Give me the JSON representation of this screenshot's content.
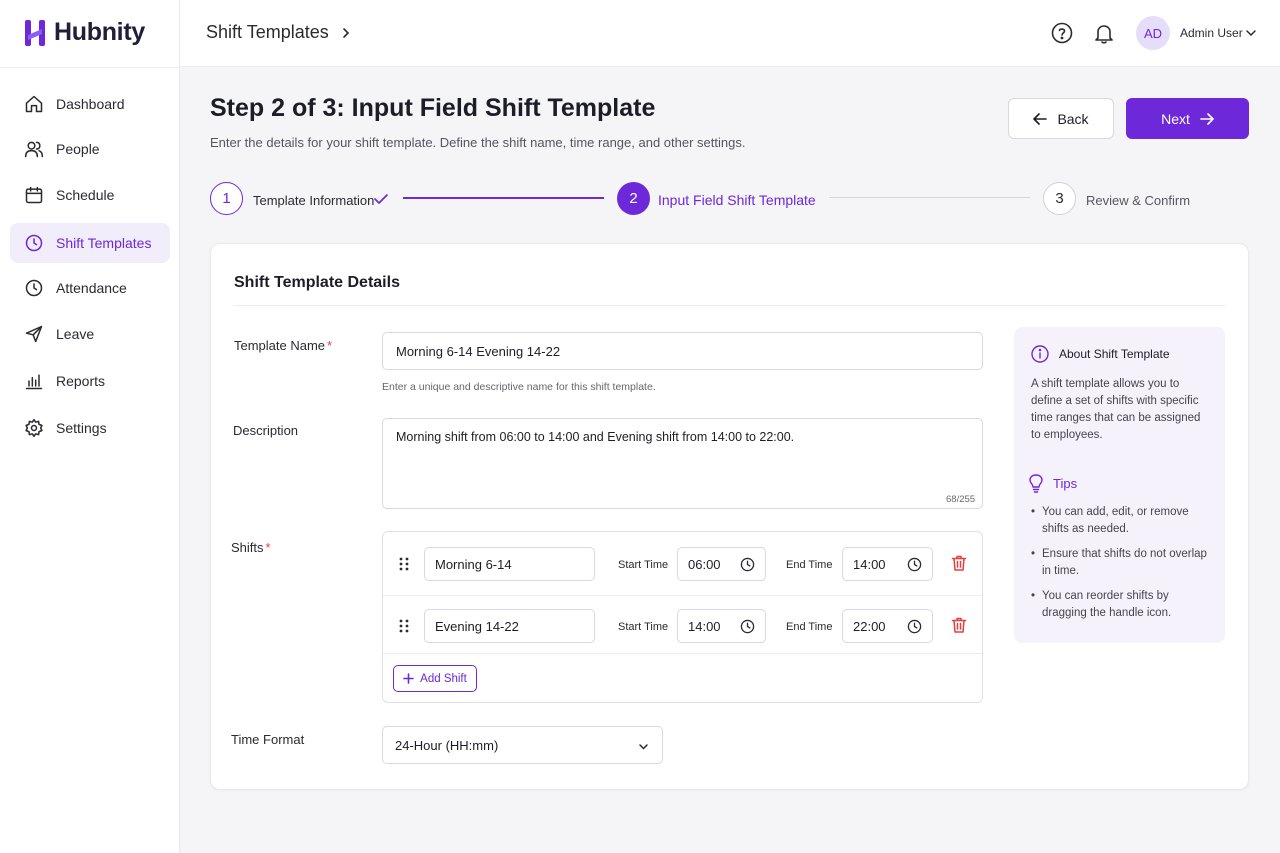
{
  "brand": {
    "name": "Hubnity",
    "accent": "#6d28d9"
  },
  "sidebar": {
    "items": [
      {
        "label": "Dashboard",
        "icon": "home-icon"
      },
      {
        "label": "People",
        "icon": "users-icon"
      },
      {
        "label": "Schedule",
        "icon": "calendar-icon"
      },
      {
        "label": "Shift Templates",
        "icon": "clock-icon",
        "active": true
      },
      {
        "label": "Attendance",
        "icon": "clock-icon"
      },
      {
        "label": "Leave",
        "icon": "send-icon"
      },
      {
        "label": "Reports",
        "icon": "bar-chart-icon"
      },
      {
        "label": "Settings",
        "icon": "gear-icon"
      }
    ]
  },
  "header": {
    "breadcrumb": "Shift Templates",
    "user": {
      "initials": "AD",
      "name": "Admin User"
    }
  },
  "page": {
    "title": "Step 2 of 3: Input Field Shift Template",
    "subtitle": "Enter the details for your shift template. Define the shift name, time range, and other settings.",
    "back_label": "Back",
    "next_label": "Next"
  },
  "stepper": {
    "steps": [
      {
        "number": "1",
        "label": "Template Information",
        "state": "done"
      },
      {
        "number": "2",
        "label": "Input Field Shift Template",
        "state": "active"
      },
      {
        "number": "3",
        "label": "Review & Confirm",
        "state": "pending"
      }
    ]
  },
  "form": {
    "section_title": "Shift Template Details",
    "template_name": {
      "label": "Template Name",
      "value": "Morning 6-14 Evening 14-22",
      "hint": "Enter a unique and descriptive name for this shift template."
    },
    "description": {
      "label": "Description",
      "value": "Morning shift from 06:00 to 14:00 and Evening shift from 14:00 to 22:00.",
      "counter": "68/255"
    },
    "shifts": {
      "label": "Shifts",
      "start_label": "Start Time",
      "end_label": "End Time",
      "items": [
        {
          "name": "Morning 6-14",
          "start": "06:00",
          "end": "14:00"
        },
        {
          "name": "Evening 14-22",
          "start": "14:00",
          "end": "22:00"
        }
      ],
      "add_label": "Add Shift"
    },
    "time_format": {
      "label": "Time Format",
      "value": "24-Hour (HH:mm)"
    }
  },
  "info_panel": {
    "title": "About Shift Template",
    "body": "A shift template allows you to define a set of shifts with specific time ranges that can be assigned to employees.",
    "tips_title": "Tips",
    "tips": [
      "You can add, edit, or remove shifts as needed.",
      "Ensure that shifts do not overlap in time.",
      "You can reorder shifts by dragging the handle icon."
    ]
  }
}
